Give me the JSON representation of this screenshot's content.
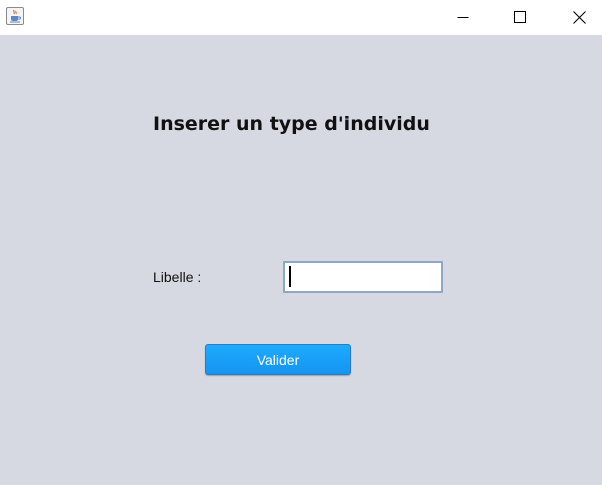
{
  "form": {
    "heading": "Inserer un type d'individu",
    "libelle_label": "Libelle :",
    "libelle_value": "",
    "submit_label": "Valider"
  },
  "colors": {
    "content_background": "#d6d9e2",
    "button_background": "#1ba3ff",
    "input_border": "#8ea6c8"
  },
  "icons": {
    "app": "java-cup-icon",
    "minimize": "minimize-icon",
    "maximize": "maximize-icon",
    "close": "close-icon"
  }
}
